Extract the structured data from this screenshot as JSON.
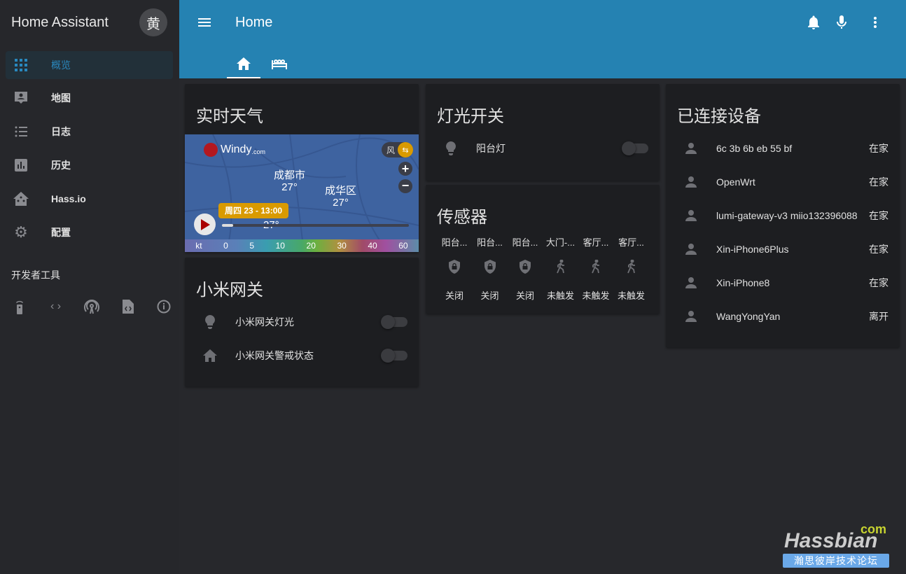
{
  "sidebar": {
    "title": "Home Assistant",
    "avatar": "黄",
    "items": [
      {
        "label": "概览",
        "icon": "apps-icon"
      },
      {
        "label": "地图",
        "icon": "map-account-icon"
      },
      {
        "label": "日志",
        "icon": "logbook-icon"
      },
      {
        "label": "历史",
        "icon": "chart-bar-icon"
      },
      {
        "label": "Hass.io",
        "icon": "hassio-icon"
      },
      {
        "label": "配置",
        "icon": "gear-icon"
      }
    ],
    "dev_tools_title": "开发者工具",
    "dev_tools": [
      "remote-icon",
      "code-icon",
      "antenna-icon",
      "file-code-icon",
      "info-icon"
    ]
  },
  "header": {
    "title": "Home",
    "tabs": [
      "home-icon",
      "bed-icon"
    ]
  },
  "colors": {
    "header": "#2582b2",
    "accent": "#2a88be",
    "windy_badge": "#d99a00"
  },
  "weather": {
    "title": "实时天气",
    "brand": "Windy",
    "brand_suffix": ".com",
    "layer": "风",
    "city1": "成都市",
    "temp1": "27°",
    "city2": "成华区",
    "temp2": "27°",
    "temp3": "27°",
    "time": "周四 23 - 13:00",
    "scale": [
      "kt",
      "0",
      "5",
      "10",
      "20",
      "30",
      "40",
      "60"
    ]
  },
  "xiaomi": {
    "title": "小米网关",
    "rows": [
      {
        "name": "小米网关灯光",
        "icon": "lightbulb-icon",
        "on": false
      },
      {
        "name": "小米网关警戒状态",
        "icon": "home-icon",
        "on": false
      }
    ]
  },
  "lights": {
    "title": "灯光开关",
    "rows": [
      {
        "name": "阳台灯",
        "icon": "lightbulb-icon",
        "on": false
      }
    ]
  },
  "sensors": {
    "title": "传感器",
    "items": [
      {
        "name": "阳台...",
        "icon": "shield-lock-icon",
        "state": "关闭"
      },
      {
        "name": "阳台...",
        "icon": "shield-lock-icon",
        "state": "关闭"
      },
      {
        "name": "阳台...",
        "icon": "shield-lock-icon",
        "state": "关闭"
      },
      {
        "name": "大门-...",
        "icon": "walk-icon",
        "state": "未触发"
      },
      {
        "name": "客厅...",
        "icon": "walk-icon",
        "state": "未触发"
      },
      {
        "name": "客厅...",
        "icon": "walk-icon",
        "state": "未触发"
      }
    ]
  },
  "devices": {
    "title": "已连接设备",
    "rows": [
      {
        "name": "6c 3b 6b eb 55 bf",
        "state": "在家"
      },
      {
        "name": "OpenWrt",
        "state": "在家"
      },
      {
        "name": "lumi-gateway-v3 miio132396088",
        "state": "在家"
      },
      {
        "name": "Xin-iPhone6Plus",
        "state": "在家"
      },
      {
        "name": "Xin-iPhone8",
        "state": "在家"
      },
      {
        "name": "WangYongYan",
        "state": "离开"
      }
    ]
  },
  "watermark": {
    "brand": "Hassbian",
    "suffix": "com",
    "subtitle": "瀚思彼岸技术论坛"
  }
}
